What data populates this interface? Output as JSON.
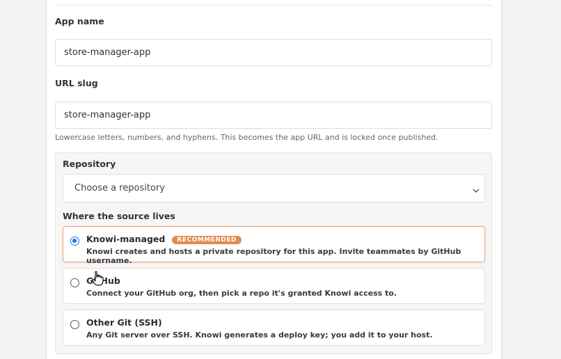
{
  "form": {
    "app_name_label": "App name",
    "app_name_value": "store-manager-app",
    "url_slug_label": "URL slug",
    "url_slug_value": "store-manager-app",
    "url_slug_help": "Lowercase letters, numbers, and hyphens. This becomes the app URL and is locked once published."
  },
  "repository": {
    "label": "Repository",
    "select_placeholder": "Choose a repository",
    "source_label": "Where the source lives",
    "options": [
      {
        "title": "Knowi-managed",
        "badge": "RECOMMENDED",
        "description": "Knowi creates and hosts a private repository for this app. Invite teammates by GitHub username.",
        "selected": true
      },
      {
        "title": "GitHub",
        "description": "Connect your GitHub org, then pick a repo it's granted Knowi access to.",
        "selected": false
      },
      {
        "title": "Other Git (SSH)",
        "description": "Any Git server over SSH. Knowi generates a deploy key; you add it to your host.",
        "selected": false
      }
    ]
  },
  "icons": {
    "select_chevron": "chevron-down-icon",
    "cursor": "hand-pointer-icon"
  },
  "colors": {
    "accent_badge": "#e28b4f",
    "radio_checked": "#1a73e8",
    "selected_border": "#e5a57f"
  }
}
